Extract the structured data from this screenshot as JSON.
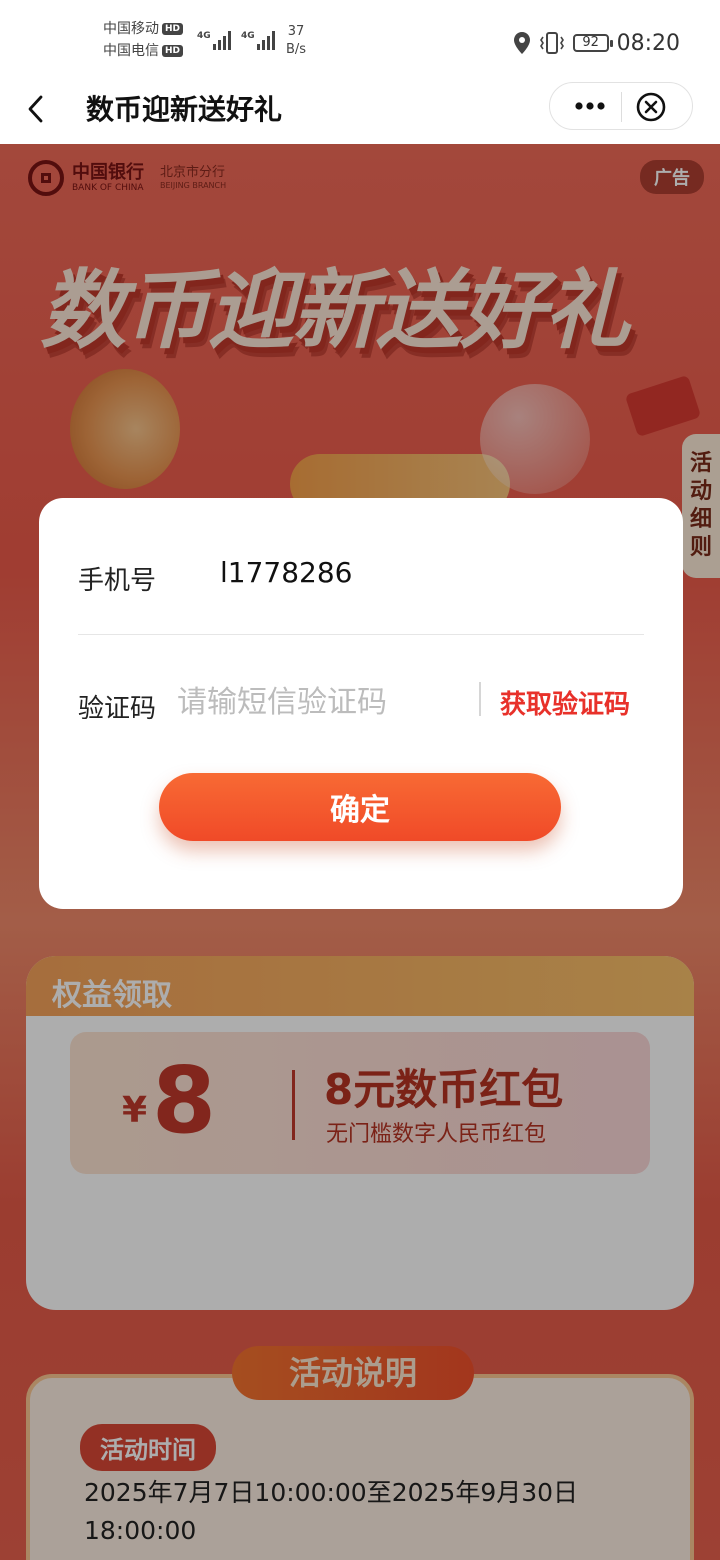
{
  "status_bar": {
    "carrier_1": "中国移动",
    "carrier_2": "中国电信",
    "hd": "HD",
    "net_type": "4G",
    "net_speed_value": "37",
    "net_speed_unit": "B/s",
    "battery": "92",
    "time": "08:20"
  },
  "navbar": {
    "title": "数币迎新送好礼"
  },
  "banner": {
    "bank_name": "中国银行",
    "bank_en": "BANK OF CHINA",
    "branch": "北京市分行",
    "branch_en": "BEIJING BRANCH",
    "ad": "广告",
    "hero_title": "数币迎新送好礼",
    "side_tab": "活动细则"
  },
  "benefit": {
    "title": "权益领取",
    "currency": "¥",
    "amount": "8",
    "name": "8元数币红包",
    "desc": "无门槛数字人民币红包"
  },
  "explain": {
    "title": "活动说明",
    "time_tag": "活动时间",
    "time_text": "2025年7月7日10:00:00至2025年9月30日18:00:00"
  },
  "modal": {
    "phone_label": "手机号",
    "phone_value": "l1778286",
    "code_label": "验证码",
    "code_placeholder": "请输短信验证码",
    "get_code": "获取验证码",
    "confirm": "确定"
  },
  "colors": {
    "accent_red": "#e8312a",
    "button_orange": "#f86a34"
  }
}
